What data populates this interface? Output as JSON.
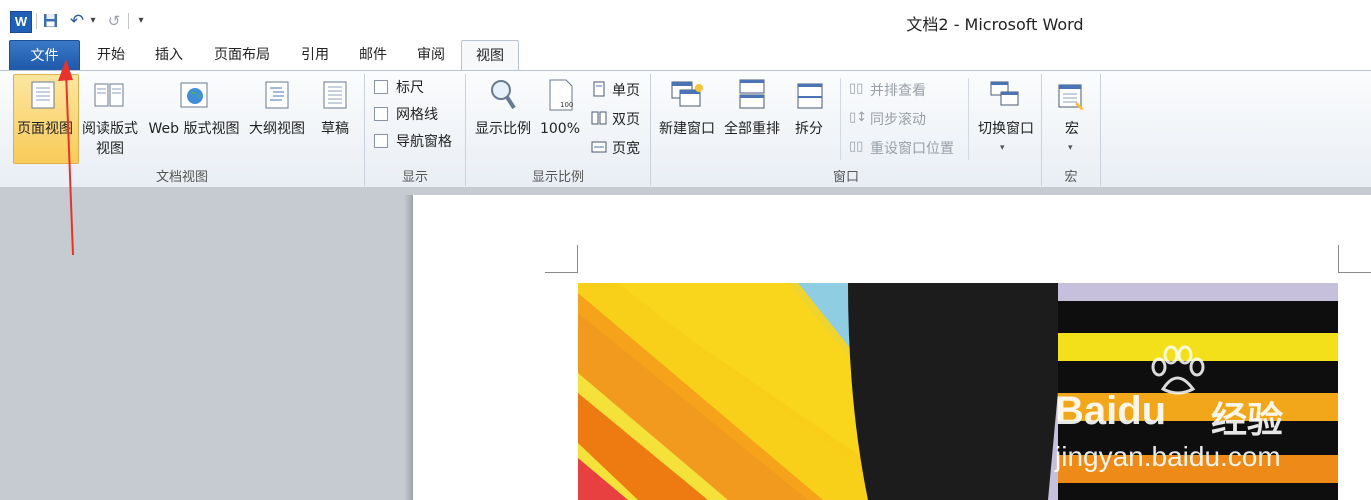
{
  "window": {
    "title": "文档2 - Microsoft Word"
  },
  "quick_access": {
    "app_icon": "W",
    "undo_glyph": "↶",
    "dropdown_glyph": "▾",
    "redo_glyph": "↺",
    "customize_glyph": "▾"
  },
  "tabs": [
    "文件",
    "开始",
    "插入",
    "页面布局",
    "引用",
    "邮件",
    "审阅",
    "视图"
  ],
  "ribbon": {
    "doc_views": {
      "label": "文档视图",
      "buttons": [
        "页面视图",
        "阅读版式",
        "视图",
        "Web 版式视图",
        "大纲视图",
        "草稿"
      ]
    },
    "show": {
      "label": "显示",
      "checks": [
        "标尺",
        "网格线",
        "导航窗格"
      ]
    },
    "zoom": {
      "label": "显示比例",
      "buttons": [
        "显示比例",
        "100%"
      ],
      "small": [
        "单页",
        "双页",
        "页宽"
      ]
    },
    "window": {
      "label": "窗口",
      "buttons": [
        "新建窗口",
        "全部重排",
        "拆分"
      ],
      "small": [
        "并排查看",
        "同步滚动",
        "重设窗口位置"
      ],
      "switch": "切换窗口"
    },
    "macros": {
      "label": "宏",
      "button": "宏"
    }
  },
  "watermark": {
    "brand": "Bai",
    "brand2": "du",
    "cn": "经验",
    "url": "jingyan.baidu.com"
  },
  "colors": {
    "file_tab": "#1e58a8",
    "arrow": "#e8322e",
    "selected_button": "#f8cb5a"
  }
}
